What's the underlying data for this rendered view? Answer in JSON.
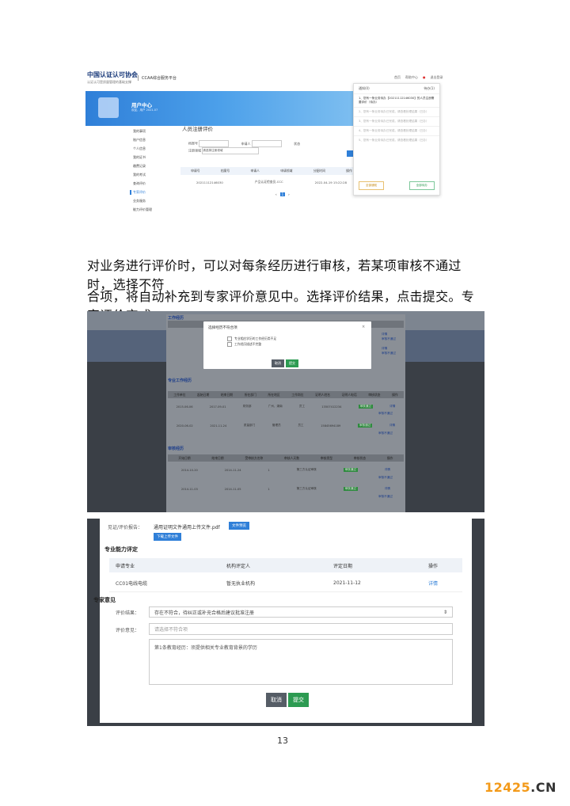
{
  "shot1": {
    "logo": "中国认证认可协会",
    "logo_sub": "认证认可是质量管理的基础支撑",
    "platform": "CCAA综合服务平台",
    "top_links": [
      "首页",
      "帮助中心",
      "退出登录"
    ],
    "user_center": "用户中心",
    "user_info": "欢迎，用户 2021-07",
    "sidebar": [
      "我的事项",
      "账户信息",
      "个人信息",
      "我的证书",
      "缴费记录",
      "我的考试",
      "查询评价",
      "专家评价",
      "业务服务",
      "能力评价管理"
    ],
    "sidebar_active": 7,
    "page_title": "人员注册评价",
    "filters": [
      "档案号",
      "申请人",
      "状态",
      "注册领域"
    ],
    "filter_select_value": "请选择注册领域",
    "table_headers": [
      "申请号",
      "档案号",
      "申请人",
      "申请领域",
      "分配时间",
      "操作"
    ],
    "table_row": [
      "20211112146030",
      "",
      "",
      "产品认证检查员-CCC",
      "2022-04-19 15:22:28",
      ""
    ],
    "pager_current": "1",
    "dropdown_tabs": [
      "通知(0)",
      "待办(1)"
    ],
    "dropdown_items": [
      "1、您有一条业务待办【20211112146030】的人员注册需要评价（待办）",
      "2、您有一条业务待办已完成，请查看处理结果（已办）",
      "3、您有一条业务待办已完成，请查看处理结果（已办）",
      "4、您有一条业务待办已完成，请查看处理结果（已办）",
      "5、您有一条业务待办已完成，请查看处理结果（已办）"
    ],
    "dropdown_buttons": [
      "全部通知",
      "全部待办"
    ]
  },
  "paragraph": [
    "对业务进行评价时，可以对每条经历进行审核，若某项审核不通过时，选择不符",
    "合项，将自动补充到专家评价意见中。选择评价结果，点击提交。专家评价完成。"
  ],
  "shot2": {
    "sections": [
      "工作经历",
      "专业工作经历",
      "审核经历"
    ],
    "work_headers": [
      "工作单位",
      "起始日期",
      "结束日期",
      "所在部门",
      "职务/职称",
      "操作"
    ],
    "work_link": "详情",
    "work_link2": "审核不通过",
    "pro_headers": [
      "工作单位",
      "起始日期",
      "结束日期",
      "所在部门",
      "所在地区",
      "工作岗位",
      "证明人姓名",
      "证明人电话",
      "审核状态",
      "操作"
    ],
    "pro_rows": [
      [
        "",
        "2015-06-06",
        "2017-09-01",
        "财务部",
        "广州、湖南",
        "员工",
        "",
        "13507412234",
        "审核通过",
        "详情"
      ],
      [
        "",
        "2020-06-02",
        "2021-11-24",
        "质量部门",
        "管理员",
        "员工",
        "",
        "15845694189",
        "审核通过",
        "详情"
      ]
    ],
    "audit_headers": [
      "开始日期",
      "结束日期",
      "受审核方名称",
      "审核人天数",
      "审核类型",
      "审核状态",
      "操作"
    ],
    "audit_rows": [
      [
        "2014-10-20",
        "2014-11-24",
        "",
        "1",
        "第三方认证审核",
        "审核通过",
        "详情"
      ],
      [
        "2014-11-03",
        "2014-11-05",
        "",
        "1",
        "第三方认证审核",
        "审核通过",
        "详情"
      ]
    ],
    "modal_title": "选择经历不符合项",
    "modal_options": [
      "专业相应学历的工作经历类不足",
      "工作经历描述不完整"
    ],
    "modal_cancel": "取消",
    "modal_submit": "提交"
  },
  "shot3": {
    "report_label": "见证/评价报告：",
    "report_file": "通用证明文件通用上传文件.pdf",
    "preview_btn": "文件预览",
    "upload_btn": "下载上传文件",
    "ability_title": "专业能力评定",
    "table_headers": [
      "申请专业",
      "机构评定人",
      "评定日期",
      "操作"
    ],
    "table_row": [
      "CC01电线电缆",
      "暂无执业机构",
      "2021-11-12",
      "详情"
    ],
    "opinion_title": "专家意见",
    "result_label": "评价结果：",
    "result_value": "存在不符合，待纠正或补充合格后建议批准注册",
    "opinion_label": "评价意见：",
    "opinion_placeholder": "请选择不符合项",
    "textarea_text": "第1条教育经历：须提供相关专业教育背景的学历",
    "cancel": "取消",
    "submit": "提交"
  },
  "page_number": "13",
  "watermark": {
    "num": "12425",
    "dom": ".CN"
  },
  "colors": {
    "primary": "#2f7fd8",
    "success": "#2d9b52",
    "dark": "#565d66"
  }
}
